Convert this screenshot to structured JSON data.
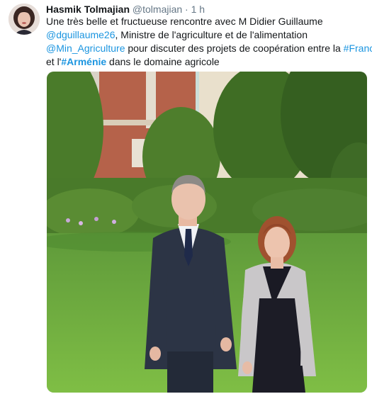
{
  "author": {
    "name": "Hasmik Tolmajian",
    "handle": "@tolmajian",
    "separator": "·",
    "time": "1 h"
  },
  "tweet": {
    "line1": "Une très belle et fructueuse rencontre avec M Didier Guillaume",
    "mention1": "@dguillaume26",
    "line2_rest": ", Ministre de l'agriculture et de l'alimentation",
    "mention2": "@Min_Agriculture",
    "line3_mid": " pour discuter des projets de coopération entre la ",
    "hashtag1": "#France",
    "line4_start": "et l'",
    "hashtag2": "#Arménie",
    "line4_end": " dans le domaine agricole"
  },
  "colors": {
    "link": "#1b95e0",
    "text": "#14171a",
    "muted": "#657786"
  },
  "media": {
    "icon": "photo-image"
  }
}
